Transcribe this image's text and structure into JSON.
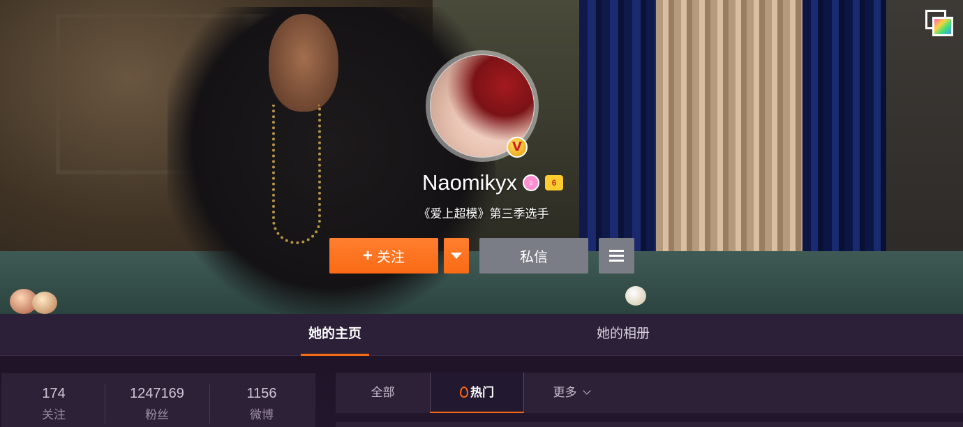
{
  "profile": {
    "username": "Naomikyx",
    "bio": "《爱上超模》第三季选手",
    "verified_badge_text": "V",
    "gender_icon": "female-icon",
    "vip_icon": "vip-crown-icon",
    "vip_text": "6"
  },
  "actions": {
    "follow_label": "关注",
    "follow_plus": "+",
    "message_label": "私信"
  },
  "tabs": [
    {
      "label": "她的主页",
      "active": true
    },
    {
      "label": "她的相册",
      "active": false
    }
  ],
  "stats": [
    {
      "value": "174",
      "label": "关注"
    },
    {
      "value": "1247169",
      "label": "粉丝"
    },
    {
      "value": "1156",
      "label": "微博"
    }
  ],
  "feed_tabs": [
    {
      "label": "全部",
      "active": false
    },
    {
      "label": "热门",
      "active": true
    },
    {
      "label": "更多",
      "active": false
    }
  ],
  "colors": {
    "accent": "#fa6a14",
    "button_gray": "#7b7d86",
    "panel": "#2c2137"
  }
}
